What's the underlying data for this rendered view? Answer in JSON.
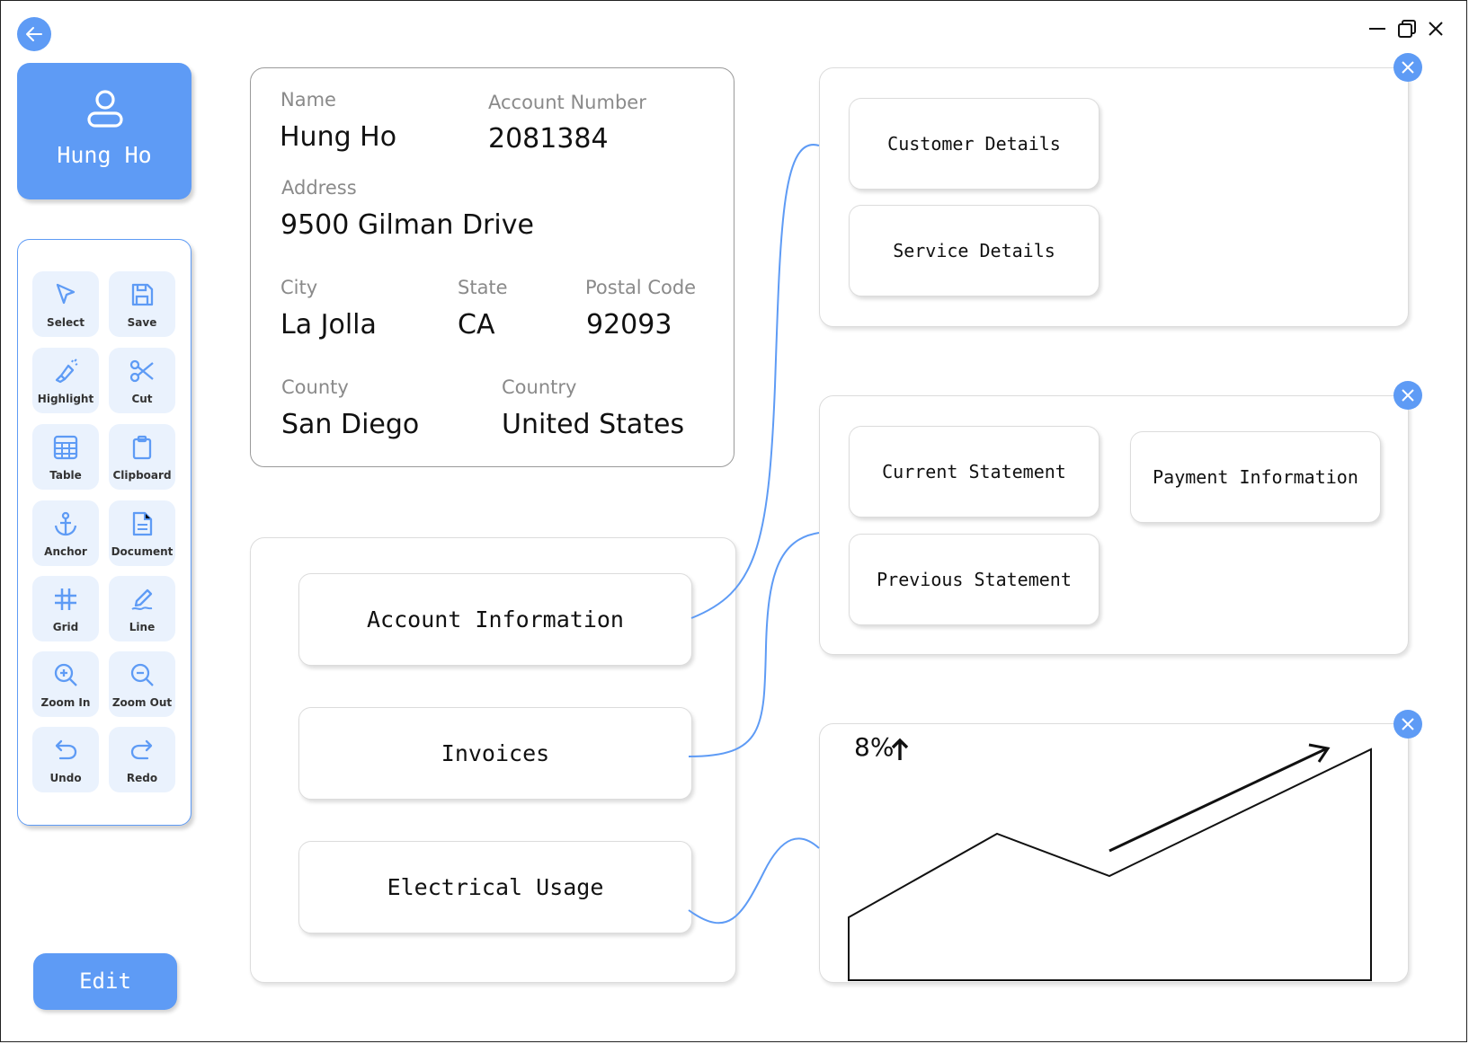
{
  "user": {
    "name": "Hung Ho"
  },
  "tools": [
    {
      "label": "Select",
      "icon": "cursor-icon"
    },
    {
      "label": "Save",
      "icon": "save-icon"
    },
    {
      "label": "Highlight",
      "icon": "highlighter-icon"
    },
    {
      "label": "Cut",
      "icon": "scissors-icon"
    },
    {
      "label": "Table",
      "icon": "table-icon"
    },
    {
      "label": "Clipboard",
      "icon": "clipboard-icon"
    },
    {
      "label": "Anchor",
      "icon": "anchor-icon"
    },
    {
      "label": "Document",
      "icon": "document-icon"
    },
    {
      "label": "Grid",
      "icon": "grid-icon"
    },
    {
      "label": "Line",
      "icon": "pen-line-icon"
    },
    {
      "label": "Zoom In",
      "icon": "zoom-in-icon"
    },
    {
      "label": "Zoom Out",
      "icon": "zoom-out-icon"
    },
    {
      "label": "Undo",
      "icon": "undo-icon"
    },
    {
      "label": "Redo",
      "icon": "redo-icon"
    }
  ],
  "edit_label": "Edit",
  "account": {
    "name_label": "Name",
    "name": "Hung Ho",
    "number_label": "Account Number",
    "number": "2081384",
    "address_label": "Address",
    "address": "9500 Gilman Drive",
    "city_label": "City",
    "city": "La Jolla",
    "state_label": "State",
    "state": "CA",
    "postal_label": "Postal Code",
    "postal": "92093",
    "county_label": "County",
    "county": "San Diego",
    "country_label": "Country",
    "country": "United States"
  },
  "nav": {
    "account_info": "Account Information",
    "invoices": "Invoices",
    "electrical_usage": "Electrical Usage"
  },
  "account_panel": {
    "customer_details": "Customer Details",
    "service_details": "Service Details"
  },
  "invoice_panel": {
    "current_statement": "Current Statement",
    "payment_information": "Payment Information",
    "previous_statement": "Previous Statement"
  },
  "usage_panel": {
    "change": "8%",
    "trend": "up"
  },
  "colors": {
    "accent": "#5e9bf5",
    "tool_bg": "#eaf2fd"
  }
}
